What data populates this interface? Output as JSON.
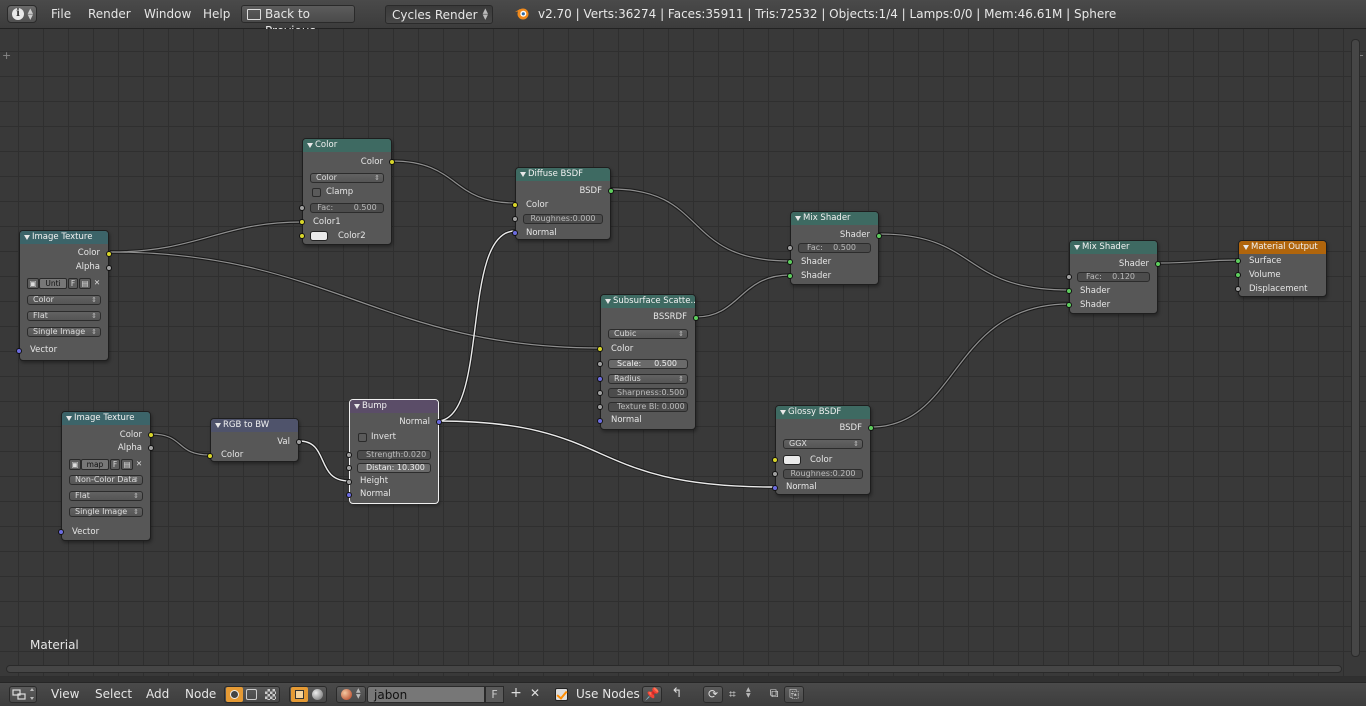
{
  "top_header": {
    "menus": [
      "File",
      "Render",
      "Window",
      "Help"
    ],
    "back_button": "Back to Previous",
    "render_engine": "Cycles Render",
    "stats": "v2.70 | Verts:36274 | Faces:35911 | Tris:72532 | Objects:1/4 | Lamps:0/0 | Mem:46.61M | Sphere"
  },
  "editor": {
    "area_label": "Material",
    "nodes": {
      "color_mix": {
        "title": "Color",
        "out": "Color",
        "blend": "Color",
        "clamp": "Clamp",
        "fac_label": "Fac:",
        "fac": "0.500",
        "in1": "Color1",
        "in2": "Color2"
      },
      "image_tex1": {
        "title": "Image Texture",
        "out_color": "Color",
        "out_alpha": "Alpha",
        "image": "Unti",
        "fake": "F",
        "color_space": "Color",
        "projection": "Flat",
        "source": "Single Image",
        "vector": "Vector"
      },
      "image_tex2": {
        "title": "Image Texture",
        "out_color": "Color",
        "out_alpha": "Alpha",
        "image": "map",
        "fake": "F",
        "color_space": "Non-Color Data",
        "projection": "Flat",
        "source": "Single Image",
        "vector": "Vector"
      },
      "rgb_bw": {
        "title": "RGB to BW",
        "out": "Val",
        "in": "Color"
      },
      "bump": {
        "title": "Bump",
        "out": "Normal",
        "invert": "Invert",
        "strength": "Strength:0.020",
        "distance": "Distan: 10.300",
        "height": "Height",
        "normal": "Normal"
      },
      "diffuse": {
        "title": "Diffuse BSDF",
        "out": "BSDF",
        "color": "Color",
        "roughness": "Roughnes:0.000",
        "normal": "Normal"
      },
      "sss": {
        "title": "Subsurface Scatte...",
        "out": "BSSRDF",
        "falloff": "Cubic",
        "color": "Color",
        "scale": "Scale:",
        "scale_val": "0.500",
        "radius": "Radius",
        "sharpness": "Sharpness:0.500",
        "texture_blur": "Texture Bl: 0.000",
        "normal": "Normal"
      },
      "mix1": {
        "title": "Mix Shader",
        "out": "Shader",
        "fac_label": "Fac:",
        "fac": "0.500",
        "in1": "Shader",
        "in2": "Shader"
      },
      "mix2": {
        "title": "Mix Shader",
        "out": "Shader",
        "fac_label": "Fac:",
        "fac": "0.120",
        "in1": "Shader",
        "in2": "Shader"
      },
      "glossy": {
        "title": "Glossy BSDF",
        "out": "BSDF",
        "distribution": "GGX",
        "color": "Color",
        "roughness": "Roughnes:0.200",
        "normal": "Normal"
      },
      "output": {
        "title": "Material Output",
        "surface": "Surface",
        "volume": "Volume",
        "displacement": "Displacement"
      }
    }
  },
  "bottom_header": {
    "menus": [
      "View",
      "Select",
      "Add",
      "Node"
    ],
    "material_name": "jabon",
    "fake_user": "F",
    "use_nodes": "Use Nodes"
  },
  "colors": {
    "socket_color": "#d9d62a",
    "socket_shader": "#5ece5e",
    "socket_vector": "#6c6ce0",
    "output_header": "#b0650c",
    "shader_header": "#3e6a62"
  }
}
